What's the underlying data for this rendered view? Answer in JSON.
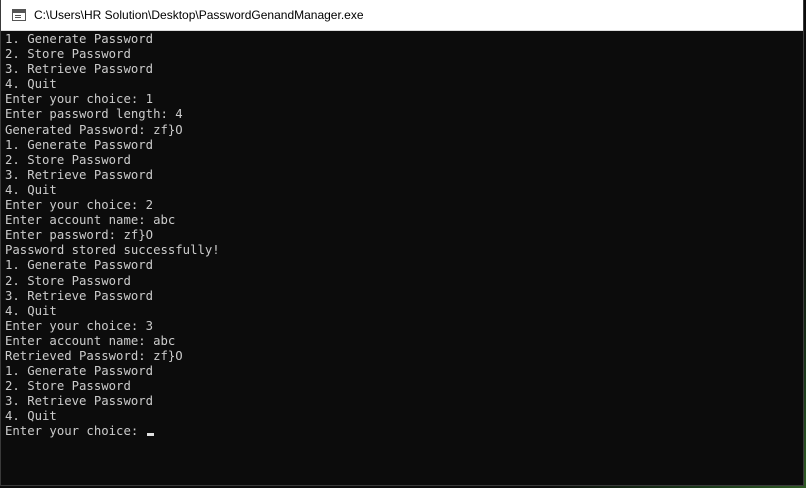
{
  "window": {
    "title": "C:\\Users\\HR Solution\\Desktop\\PasswordGenandManager.exe",
    "icon": "console-app-icon"
  },
  "console": {
    "lines": [
      "1. Generate Password",
      "2. Store Password",
      "3. Retrieve Password",
      "4. Quit",
      "Enter your choice: 1",
      "Enter password length: 4",
      "Generated Password: zf}O",
      "1. Generate Password",
      "2. Store Password",
      "3. Retrieve Password",
      "4. Quit",
      "Enter your choice: 2",
      "Enter account name: abc",
      "Enter password: zf}O",
      "Password stored successfully!",
      "1. Generate Password",
      "2. Store Password",
      "3. Retrieve Password",
      "4. Quit",
      "Enter your choice: 3",
      "Enter account name: abc",
      "Retrieved Password: zf}O",
      "1. Generate Password",
      "2. Store Password",
      "3. Retrieve Password",
      "4. Quit"
    ],
    "prompt": "Enter your choice: "
  },
  "colors": {
    "console_background": "#0c0c0c",
    "console_text": "#cccccc",
    "titlebar_background": "#ffffff"
  }
}
